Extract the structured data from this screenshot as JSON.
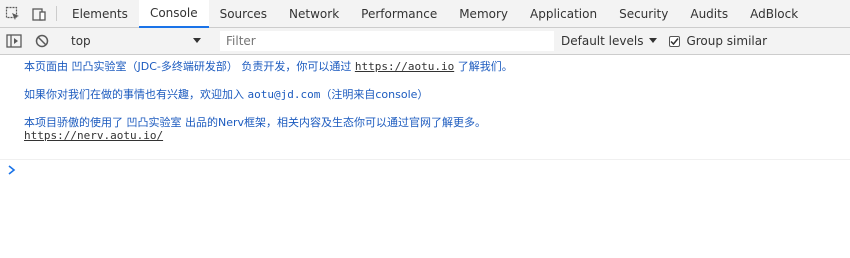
{
  "tabs": [
    {
      "label": "Elements"
    },
    {
      "label": "Console"
    },
    {
      "label": "Sources"
    },
    {
      "label": "Network"
    },
    {
      "label": "Performance"
    },
    {
      "label": "Memory"
    },
    {
      "label": "Application"
    },
    {
      "label": "Security"
    },
    {
      "label": "Audits"
    },
    {
      "label": "AdBlock"
    }
  ],
  "toolbar": {
    "context": "top",
    "filter_placeholder": "Filter",
    "levels_label": "Default levels",
    "group_similar_label": "Group similar",
    "group_similar_checked": true
  },
  "messages": {
    "m1": {
      "prefix": "本页面由 凹凸实验室（JDC-多终端研发部） 负责开发，你可以通过 ",
      "link": "https://aotu.io",
      "suffix": " 了解我们。"
    },
    "m2": {
      "prefix": "如果你对我们在做的事情也有兴趣，欢迎加入 ",
      "email": "aotu@jd.com",
      "suffix": "（注明来自console）"
    },
    "m3": {
      "text": "本项目骄傲的使用了 凹凸实验室 出品的Nerv框架，相关内容及生态你可以通过官网了解更多。",
      "link": "https://nerv.aotu.io/"
    }
  },
  "colors": {
    "accent": "#1a73e8",
    "message_text": "#1c5bbf",
    "toolbar_bg": "#f3f3f3"
  }
}
